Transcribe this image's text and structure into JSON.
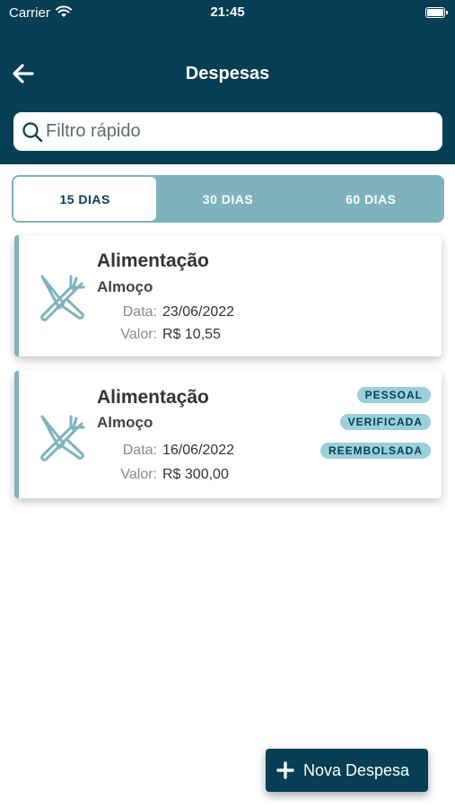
{
  "status_bar": {
    "carrier": "Carrier",
    "time": "21:45"
  },
  "nav": {
    "title": "Despesas",
    "back_icon": "arrow-left-icon"
  },
  "search": {
    "placeholder": "Filtro rápido",
    "value": "",
    "icon": "search-icon"
  },
  "tabs": [
    {
      "label": "15 DIAS",
      "active": true
    },
    {
      "label": "30 DIAS",
      "active": false
    },
    {
      "label": "60 DIAS",
      "active": false
    }
  ],
  "expenses": [
    {
      "category": "Alimentação",
      "description": "Almoço",
      "date_label": "Data:",
      "date": "23/06/2022",
      "value_label": "Valor:",
      "value": "R$ 10,55",
      "icon": "fork-knife-icon",
      "badges": []
    },
    {
      "category": "Alimentação",
      "description": "Almoço",
      "date_label": "Data:",
      "date": "16/06/2022",
      "value_label": "Valor:",
      "value": "R$ 300,00",
      "icon": "fork-knife-icon",
      "badges": [
        "PESSOAL",
        "VERIFICADA",
        "REEMBOLSADA"
      ]
    }
  ],
  "fab": {
    "label": "Nova Despesa",
    "icon": "plus-icon"
  },
  "colors": {
    "primary": "#063e55",
    "accent": "#7eb3be",
    "badge": "#9bcfda"
  }
}
